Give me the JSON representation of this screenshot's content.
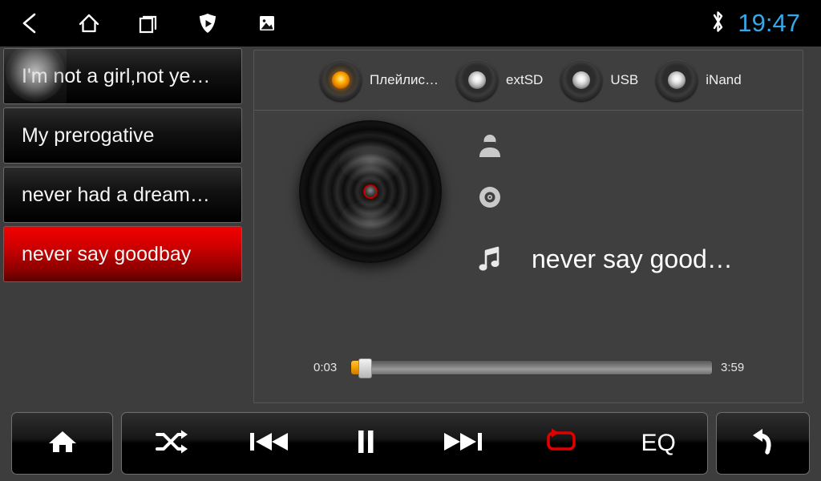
{
  "statusbar": {
    "nav_icons": [
      {
        "name": "back-icon",
        "label": "Back"
      },
      {
        "name": "home-icon",
        "label": "Home"
      },
      {
        "name": "recent-apps-icon",
        "label": "Recent apps"
      },
      {
        "name": "shield-play-icon",
        "label": "Shield"
      },
      {
        "name": "image-icon",
        "label": "Screenshot"
      }
    ],
    "bluetooth_icon": "bluetooth-icon",
    "time": "19:47",
    "time_color": "#37a7e8"
  },
  "playlist": {
    "items": [
      {
        "title": "I'm not a girl,not ye…",
        "selected": false,
        "pressed": true
      },
      {
        "title": "My prerogative",
        "selected": false,
        "pressed": false
      },
      {
        "title": "never had a dream…",
        "selected": false,
        "pressed": false
      },
      {
        "title": "never say goodbay",
        "selected": true,
        "pressed": false
      }
    ],
    "selected_color": "#e00000"
  },
  "sources": [
    {
      "label": "Плейлис…",
      "active": true
    },
    {
      "label": "extSD",
      "active": false
    },
    {
      "label": "USB",
      "active": false
    },
    {
      "label": "iNand",
      "active": false
    }
  ],
  "now_playing": {
    "album_art_icon": "vinyl-record-icon",
    "artist_icon": "person-icon",
    "artist": "",
    "album_icon": "disc-icon",
    "album": "",
    "title_icon": "music-note-icon",
    "title": "never say good…",
    "elapsed": "0:03",
    "duration": "3:59",
    "progress_percent": 1.2,
    "accent_color": "#f5a000"
  },
  "controls": {
    "home": {
      "icon": "home-filled-icon",
      "label": ""
    },
    "shuffle": {
      "icon": "shuffle-icon",
      "label": "",
      "active": false
    },
    "previous": {
      "icon": "previous-track-icon",
      "label": ""
    },
    "play_pause": {
      "icon": "pause-icon",
      "label": "",
      "state": "playing"
    },
    "next": {
      "icon": "next-track-icon",
      "label": ""
    },
    "repeat": {
      "icon": "repeat-icon",
      "label": "",
      "active": true,
      "color": "#e00000"
    },
    "eq": {
      "icon": "equalizer-label",
      "label": "EQ"
    },
    "back": {
      "icon": "return-arrow-icon",
      "label": ""
    }
  }
}
